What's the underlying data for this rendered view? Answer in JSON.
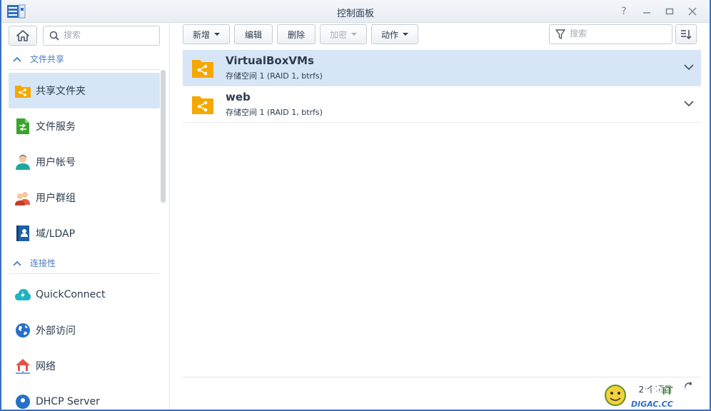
{
  "window": {
    "title": "控制面板",
    "controls": [
      "help",
      "minimize",
      "maximize",
      "close"
    ]
  },
  "sidebar": {
    "search_placeholder": "搜索",
    "sections": [
      {
        "label": "文件共享",
        "items": [
          {
            "label": "共享文件夹",
            "icon": "shared-folder-icon",
            "active": true
          },
          {
            "label": "文件服务",
            "icon": "file-services-icon"
          },
          {
            "label": "用户帐号",
            "icon": "user-icon"
          },
          {
            "label": "用户群组",
            "icon": "group-icon"
          },
          {
            "label": "域/LDAP",
            "icon": "domain-ldap-icon"
          }
        ]
      },
      {
        "label": "连接性",
        "items": [
          {
            "label": "QuickConnect",
            "icon": "quickconnect-icon"
          },
          {
            "label": "外部访问",
            "icon": "external-access-icon"
          },
          {
            "label": "网络",
            "icon": "network-icon"
          },
          {
            "label": "DHCP Server",
            "icon": "dhcp-server-icon"
          }
        ]
      }
    ]
  },
  "toolbar": {
    "create": "新增",
    "edit": "编辑",
    "delete": "删除",
    "encrypt": "加密",
    "action": "动作",
    "search_placeholder": "搜索"
  },
  "folders": [
    {
      "name": "VirtualBoxVMs",
      "location": "存储空间 1 (RAID 1, btrfs)",
      "selected": true
    },
    {
      "name": "web",
      "location": "存储空间 1 (RAID 1, btrfs)",
      "selected": false
    }
  ],
  "footer": {
    "item_count": "2 个项目"
  },
  "watermark": {
    "text": "爱人的IT信息地",
    "subtext": "DIGAC.CC"
  },
  "colors": {
    "accent": "#4a7cc0",
    "selected_bg": "#d7e6f7",
    "folder": "#f5a800"
  }
}
